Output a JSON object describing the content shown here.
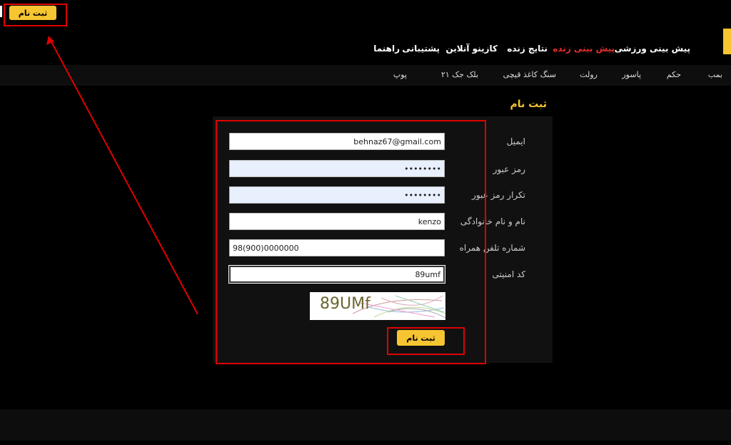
{
  "header": {
    "signup_button": "ثبت نام",
    "nav": [
      {
        "label": "پیش بینی ورزشی",
        "active": false
      },
      {
        "label": "پیش بینی زنده",
        "active": true
      },
      {
        "label": "نتایج زنده",
        "active": false
      },
      {
        "label": "کازینو آنلاین",
        "active": false
      },
      {
        "label": "پشتیبانی",
        "active": false
      },
      {
        "label": "راهنما",
        "active": false
      }
    ],
    "subnav": [
      "بمب",
      "حکم",
      "پاسور",
      "رولت",
      "سنگ کاغذ قیچی",
      "بلک جک ۲۱",
      "پوپ"
    ]
  },
  "page": {
    "title": "ثبت نام"
  },
  "form": {
    "fields": [
      {
        "label": "ایمیل",
        "value": "behnaz67@gmail.com"
      },
      {
        "label": "رمز عبور",
        "value": "••••••••"
      },
      {
        "label": "تکرار رمز عبور",
        "value": "••••••••"
      },
      {
        "label": "نام و نام خانوادگی",
        "value": "kenzo"
      },
      {
        "label": "شماره تلفن همراه",
        "value": "98(900)0000000"
      },
      {
        "label": "کد امنیتی",
        "value": "89umf"
      }
    ],
    "captcha_text": "89UMf",
    "submit_label": "ثبت نام"
  },
  "colors": {
    "accent": "#f6c531",
    "active_nav": "#e62e2e",
    "annotation": "#e00000"
  }
}
